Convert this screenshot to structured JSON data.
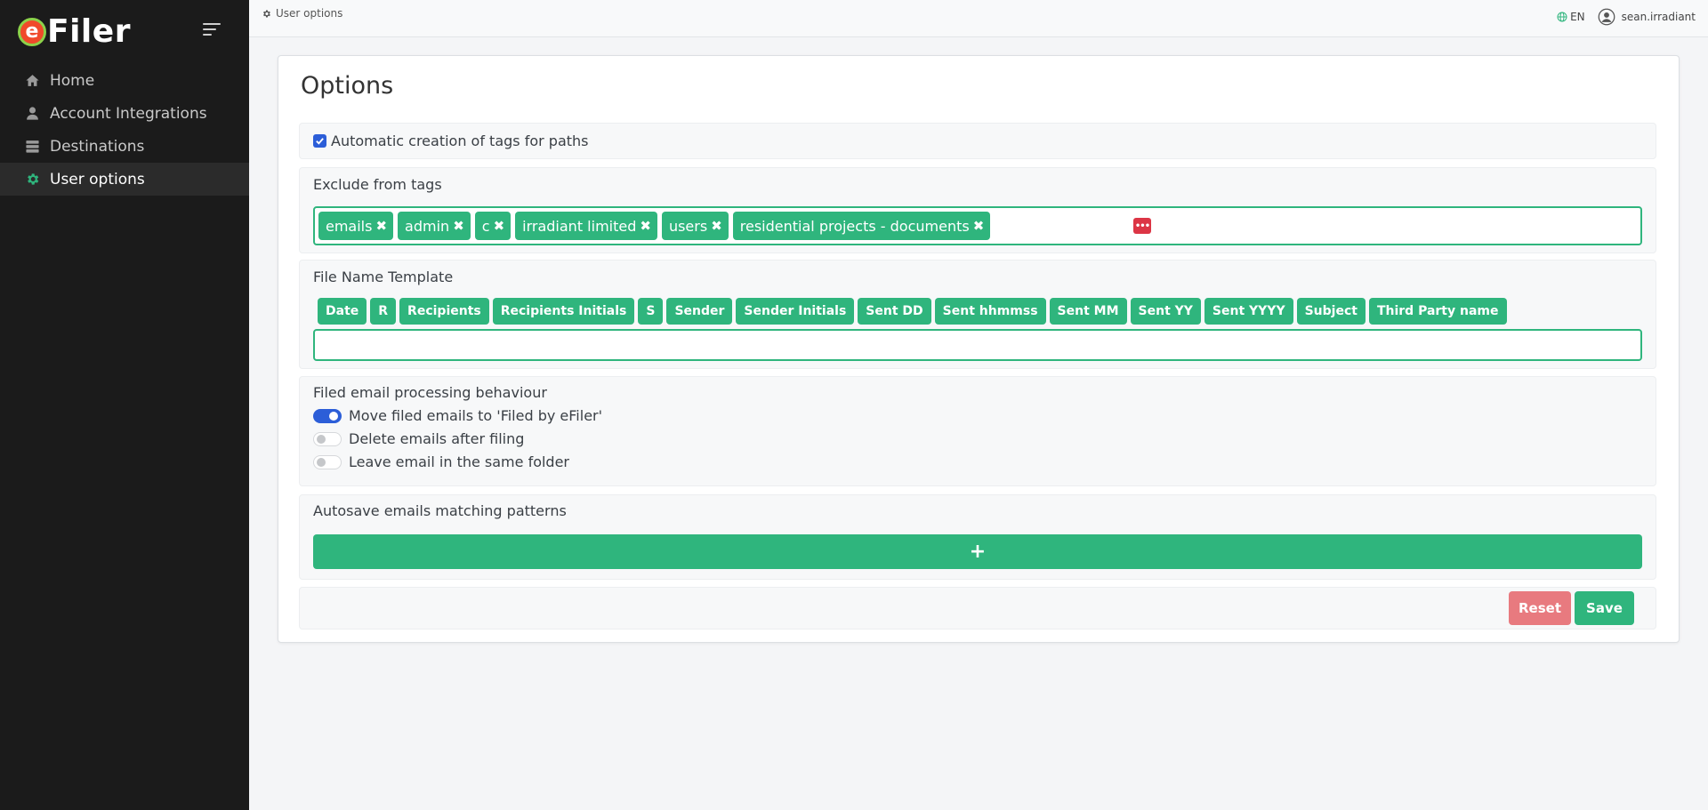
{
  "app": {
    "brand_e": "e",
    "brand_rest": "Filer"
  },
  "sidebar": {
    "items": [
      {
        "label": "Home",
        "icon": "home-icon",
        "active": false
      },
      {
        "label": "Account Integrations",
        "icon": "user-icon",
        "active": false
      },
      {
        "label": "Destinations",
        "icon": "server-icon",
        "active": false
      },
      {
        "label": "User options",
        "icon": "gear-icon",
        "active": true
      }
    ]
  },
  "topbar": {
    "breadcrumb": "User options",
    "language": "EN",
    "username": "sean.irradiant"
  },
  "page": {
    "title": "Options"
  },
  "auto_tags": {
    "label": "Automatic creation of tags for paths",
    "checked": true
  },
  "exclude_tags": {
    "label": "Exclude from tags",
    "tags": [
      "emails",
      "admin",
      "c",
      "irradiant limited",
      "users",
      "residential projects - documents"
    ],
    "remove_glyph": "✖",
    "more_glyph": "•••"
  },
  "file_name_template": {
    "label": "File Name Template",
    "chips": [
      "Date",
      "R",
      "Recipients",
      "Recipients Initials",
      "S",
      "Sender",
      "Sender Initials",
      "Sent DD",
      "Sent hhmmss",
      "Sent MM",
      "Sent YY",
      "Sent YYYY",
      "Subject",
      "Third Party name"
    ],
    "value": ""
  },
  "processing": {
    "label": "Filed email processing behaviour",
    "options": [
      {
        "label": "Move filed emails to 'Filed by eFiler'",
        "on": true
      },
      {
        "label": "Delete emails after filing",
        "on": false
      },
      {
        "label": "Leave email in the same folder",
        "on": false
      }
    ]
  },
  "autosave": {
    "label": "Autosave emails matching patterns",
    "add_label": "+"
  },
  "footer": {
    "reset_label": "Reset",
    "save_label": "Save"
  },
  "colors": {
    "accent": "#2fb57d",
    "primary": "#2c5ed8",
    "danger": "#dc3545",
    "sidebar_bg": "#1b1b1b"
  }
}
